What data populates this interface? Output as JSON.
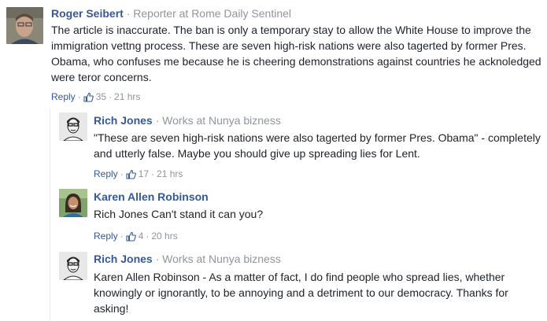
{
  "comments": [
    {
      "author": "Roger Seibert",
      "separator": "·",
      "role": "Reporter at Rome Daily Sentinel",
      "text": "The article is inaccurate. The ban is only a temporary stay to allow the White House to improve the immigration vettng process. These are seven high-risk nations were also tagerted by former Pres. Obama, who confuses me because he is cheering demonstrations against countries he acknoledged were teror concerns.",
      "reply_label": "Reply",
      "likes": "35",
      "time": "21 hrs"
    },
    {
      "author": "Rich Jones",
      "separator": "·",
      "role": "Works at Nunya bizness",
      "text": "\"These are seven high-risk nations were also tagerted by former Pres. Obama\" - completely and utterly false. Maybe you should give up spreading lies for Lent.",
      "reply_label": "Reply",
      "likes": "17",
      "time": "21 hrs"
    },
    {
      "author": "Karen Allen Robinson",
      "text": "Rich Jones Can't stand it can you?",
      "reply_label": "Reply",
      "likes": "4",
      "time": "20 hrs"
    },
    {
      "author": "Rich Jones",
      "separator": "·",
      "role": "Works at Nunya bizness",
      "text": "Karen Allen Robinson - As a matter of fact, I do find people who spread lies, whether knowingly or ignorantly, to be annoying and a detriment to our democracy. Thanks for asking!"
    }
  ],
  "action_separator": "·",
  "colors": {
    "link": "#365899",
    "meta": "#90949c",
    "text": "#1d2129"
  },
  "icons": {
    "like": "thumbs-up-icon"
  }
}
